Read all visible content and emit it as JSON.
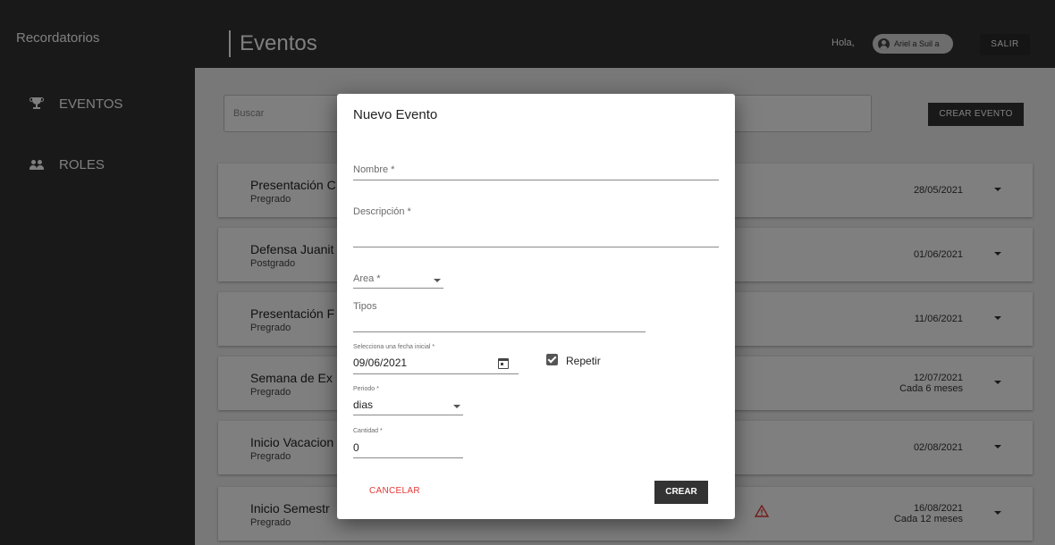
{
  "app": {
    "title": "Recordatorios"
  },
  "header": {
    "page_title": "Eventos",
    "greeting": "Hola,",
    "user_name": "Ariel a Suil a",
    "logout_label": "SALIR"
  },
  "sidebar": {
    "items": [
      {
        "label": "EVENTOS",
        "icon": "trophy-icon"
      },
      {
        "label": "ROLES",
        "icon": "people-icon"
      }
    ]
  },
  "toolbar": {
    "search_placeholder": "Buscar",
    "create_label": "CREAR EVENTO"
  },
  "events": [
    {
      "name": "Presentación C",
      "category": "Pregrado",
      "date": "28/05/2021",
      "repeat": ""
    },
    {
      "name": "Defensa Juanit",
      "category": "Postgrado",
      "date": "01/06/2021",
      "repeat": ""
    },
    {
      "name": "Presentación F",
      "category": "Pregrado",
      "date": "11/06/2021",
      "repeat": ""
    },
    {
      "name": "Semana de Ex",
      "category": "Pregrado",
      "date": "12/07/2021",
      "repeat": "Cada 6 meses"
    },
    {
      "name": "Inicio Vacacion",
      "category": "Pregrado",
      "date": "02/08/2021",
      "repeat": ""
    },
    {
      "name": "Inicio Semestr",
      "category": "Pregrado",
      "date": "16/08/2021",
      "repeat": "Cada 12 meses",
      "warning": true
    }
  ],
  "dialog": {
    "title": "Nuevo Evento",
    "nombre_label": "Nombre *",
    "descripcion_label": "Descripción *",
    "area_label": "Area *",
    "tipos_label": "Tipos",
    "fecha_label": "Selecciona una fecha inicial *",
    "fecha_value": "09/06/2021",
    "repetir_label": "Repetir",
    "repetir_checked": true,
    "periodo_label": "Periodo *",
    "periodo_value": "dias",
    "cantidad_label": "Cantidad *",
    "cantidad_value": "0",
    "cancel_label": "CANCELAR",
    "create_label": "CREAR"
  },
  "colors": {
    "dark": "#333333",
    "cancel": "#e53935",
    "warning": "#e53935"
  }
}
